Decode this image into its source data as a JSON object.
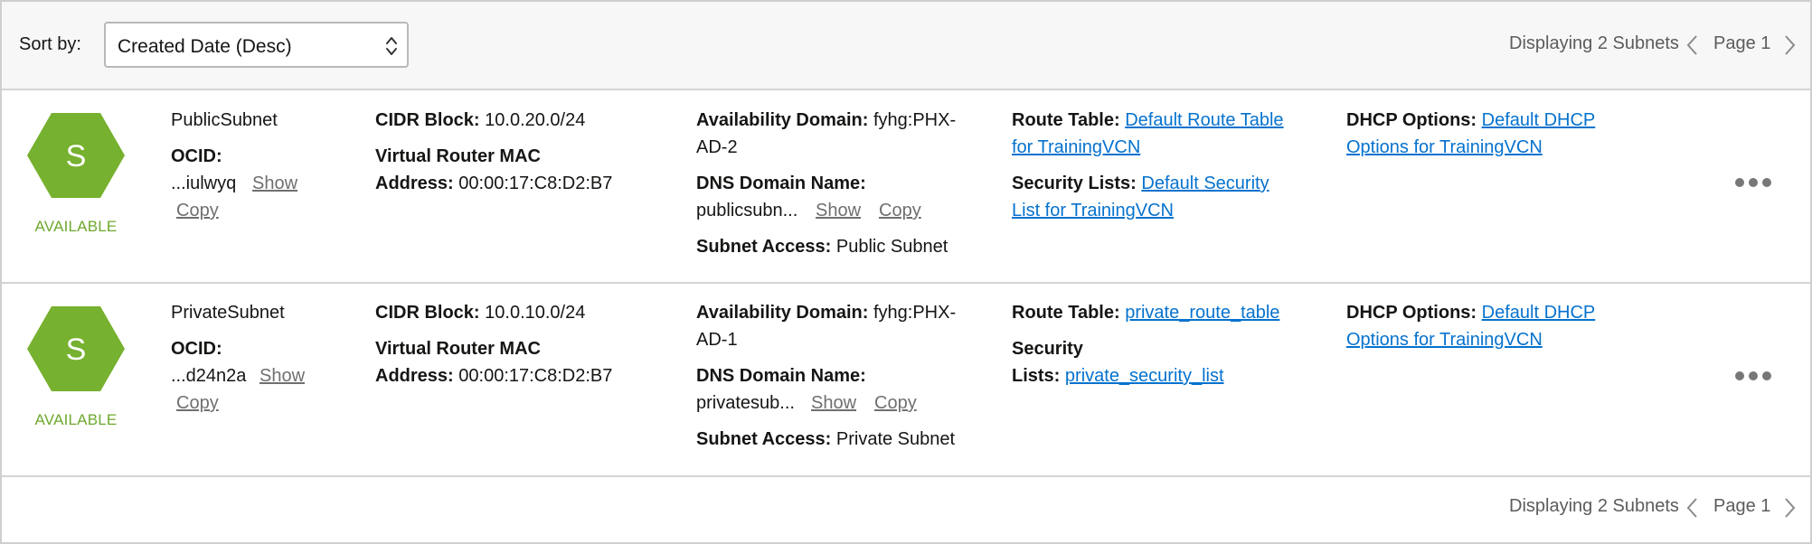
{
  "toolbar": {
    "sort_label": "Sort by:",
    "sort_value": "Created Date (Desc)",
    "display_count": "Displaying 2 Subnets",
    "page": "Page 1"
  },
  "footer": {
    "display_count": "Displaying 2 Subnets",
    "page": "Page 1"
  },
  "colors": {
    "available_green": "#6ea82e",
    "link_blue": "#0572ce"
  },
  "icons": [
    "sort-caret-icon",
    "chevron-left-icon",
    "chevron-right-icon",
    "subnet-hexagon-icon",
    "more-actions-icon"
  ],
  "subnets": [
    {
      "initial": "S",
      "state": "AVAILABLE",
      "name": "PublicSubnet",
      "ocid_label": "OCID:",
      "ocid_value": "...iulwyq",
      "show": "Show",
      "copy": "Copy",
      "cidr_label": "CIDR Block:",
      "cidr_value": "10.0.20.0/24",
      "vr_mac_label_1": "Virtual Router MAC",
      "vr_mac_label_2": "Address:",
      "vr_mac_value": "00:00:17:C8:D2:B7",
      "ad_label": "Availability Domain:",
      "ad_value_1": "fyhg:PHX-",
      "ad_value_2": "AD-2",
      "dns_label": "DNS Domain Name:",
      "dns_value": "publicsubn...",
      "access_label": "Subnet Access:",
      "access_value": "Public Subnet",
      "route_label": "Route Table:",
      "route_value_1": "Default Route Table",
      "route_value_2": "for TrainingVCN",
      "seclist_label": "Security Lists:",
      "seclist_value_1": "Default Security",
      "seclist_value_2": "List for TrainingVCN",
      "dhcp_label": "DHCP Options:",
      "dhcp_value_1": "Default DHCP",
      "dhcp_value_2": "Options for TrainingVCN"
    },
    {
      "initial": "S",
      "state": "AVAILABLE",
      "name": "PrivateSubnet",
      "ocid_label": "OCID:",
      "ocid_value": "...d24n2a",
      "show": "Show",
      "copy": "Copy",
      "cidr_label": "CIDR Block:",
      "cidr_value": "10.0.10.0/24",
      "vr_mac_label_1": "Virtual Router MAC",
      "vr_mac_label_2": "Address:",
      "vr_mac_value": "00:00:17:C8:D2:B7",
      "ad_label": "Availability Domain:",
      "ad_value_1": "fyhg:PHX-",
      "ad_value_2": "AD-1",
      "dns_label": "DNS Domain Name:",
      "dns_value": "privatesub...",
      "access_label": "Subnet Access:",
      "access_value": "Private Subnet",
      "route_label": "Route Table:",
      "route_value_1": "private_route_table",
      "seclist_label_1": "Security",
      "seclist_label_2": "Lists:",
      "seclist_value_1": "private_security_list",
      "dhcp_label": "DHCP Options:",
      "dhcp_value_1": "Default DHCP",
      "dhcp_value_2": "Options for TrainingVCN"
    }
  ]
}
